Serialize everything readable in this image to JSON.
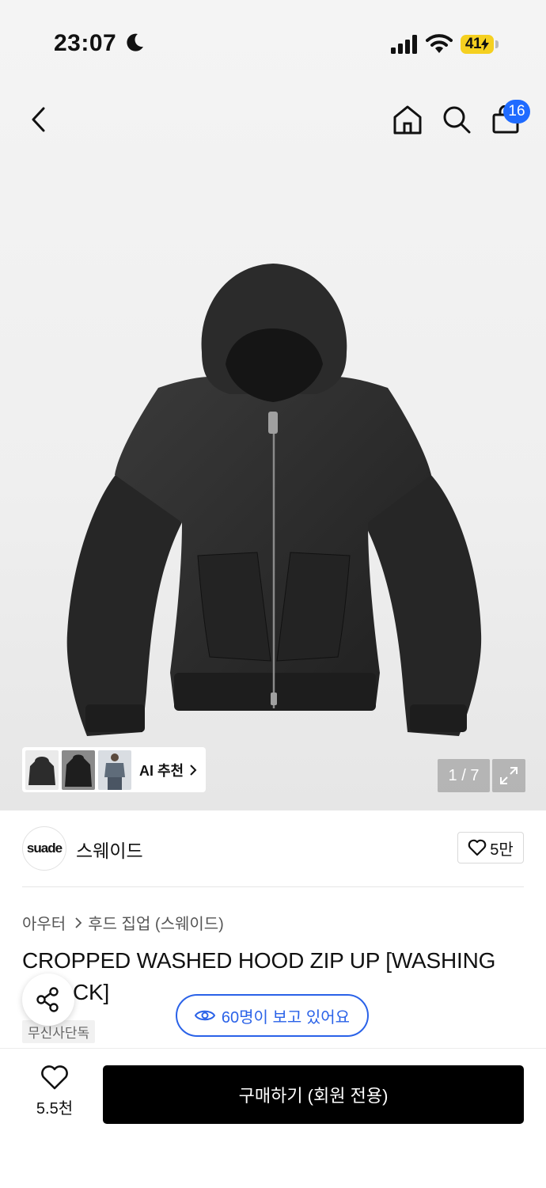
{
  "status": {
    "time": "23:07",
    "battery": "41"
  },
  "header": {
    "cart_count": "16"
  },
  "gallery": {
    "ai_label": "AI 추천",
    "pager": "1 / 7"
  },
  "brand": {
    "logo_text": "suade",
    "name": "스웨이드",
    "likes": "5만"
  },
  "breadcrumb": {
    "category": "아우터",
    "subcategory": "후드 집업 (스웨이드)"
  },
  "product": {
    "title_line1": "CROPPED WASHED HOOD ZIP UP [WASHING",
    "title_line2": "CK]",
    "tag": "무신사단독",
    "viewers": "60명이 보고 있어요"
  },
  "bottom": {
    "like_count": "5.5천",
    "buy_label": "구매하기 (회원 전용)"
  },
  "colors": {
    "accent": "#2a62e8",
    "badge": "#1f6bff",
    "battery": "#f5d020"
  }
}
